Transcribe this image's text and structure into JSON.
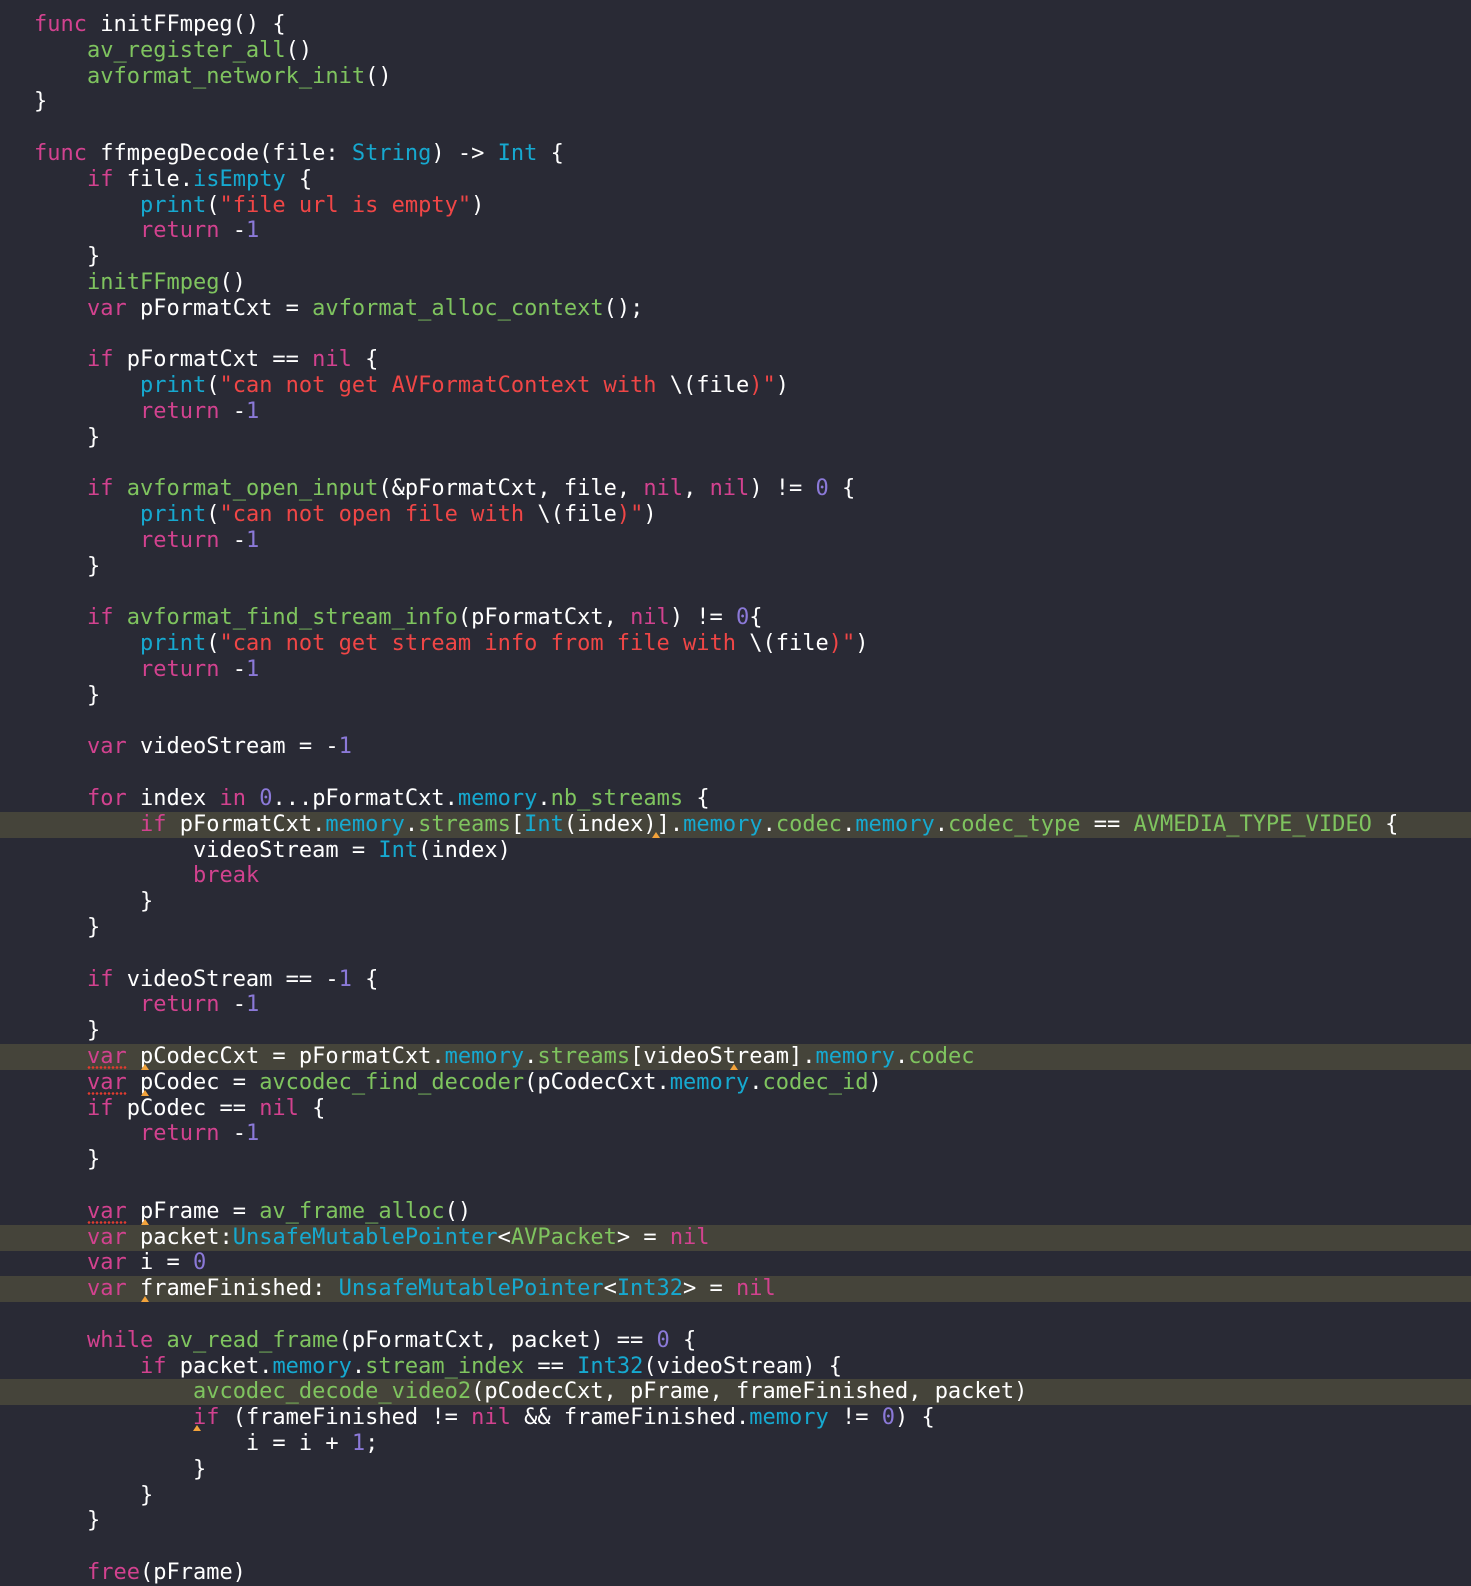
{
  "editor": {
    "language": "swift",
    "colors": {
      "background": "#292a35",
      "highlight_line": "#45443a",
      "keyword": "#d2428f",
      "function": "#7fc45f",
      "type": "#16a9d0",
      "string": "#f04646",
      "number": "#8b79d8",
      "plain": "#ffffff",
      "warning_underline": "#e23b2f",
      "warning_marker": "#f2a23a"
    },
    "lines": [
      {
        "tokens": [
          [
            "func",
            "kw"
          ],
          [
            " initFFmpeg() {",
            "plain"
          ]
        ]
      },
      {
        "tokens": [
          [
            "    ",
            "plain"
          ],
          [
            "av_register_all",
            "fn"
          ],
          [
            "()",
            "plain"
          ]
        ]
      },
      {
        "tokens": [
          [
            "    ",
            "plain"
          ],
          [
            "avformat_network_init",
            "fn"
          ],
          [
            "()",
            "plain"
          ]
        ]
      },
      {
        "tokens": [
          [
            "}",
            "plain"
          ]
        ]
      },
      {
        "tokens": []
      },
      {
        "tokens": [
          [
            "func",
            "kw"
          ],
          [
            " ffmpegDecode(file: ",
            "plain"
          ],
          [
            "String",
            "type"
          ],
          [
            ") -> ",
            "plain"
          ],
          [
            "Int",
            "type"
          ],
          [
            " {",
            "plain"
          ]
        ]
      },
      {
        "tokens": [
          [
            "    ",
            "plain"
          ],
          [
            "if",
            "kw"
          ],
          [
            " file.",
            "plain"
          ],
          [
            "isEmpty",
            "prop"
          ],
          [
            " {",
            "plain"
          ]
        ]
      },
      {
        "tokens": [
          [
            "        ",
            "plain"
          ],
          [
            "print",
            "type"
          ],
          [
            "(",
            "plain"
          ],
          [
            "\"file url is empty\"",
            "str"
          ],
          [
            ")",
            "plain"
          ]
        ]
      },
      {
        "tokens": [
          [
            "        ",
            "plain"
          ],
          [
            "return",
            "kw"
          ],
          [
            " -",
            "plain"
          ],
          [
            "1",
            "num"
          ]
        ]
      },
      {
        "tokens": [
          [
            "    }",
            "plain"
          ]
        ]
      },
      {
        "tokens": [
          [
            "    ",
            "plain"
          ],
          [
            "initFFmpeg",
            "fn"
          ],
          [
            "()",
            "plain"
          ]
        ]
      },
      {
        "tokens": [
          [
            "    ",
            "plain"
          ],
          [
            "var",
            "kw"
          ],
          [
            " pFormatCxt = ",
            "plain"
          ],
          [
            "avformat_alloc_context",
            "fn"
          ],
          [
            "();",
            "plain"
          ]
        ]
      },
      {
        "tokens": []
      },
      {
        "tokens": [
          [
            "    ",
            "plain"
          ],
          [
            "if",
            "kw"
          ],
          [
            " pFormatCxt == ",
            "plain"
          ],
          [
            "nil",
            "kw"
          ],
          [
            " {",
            "plain"
          ]
        ]
      },
      {
        "tokens": [
          [
            "        ",
            "plain"
          ],
          [
            "print",
            "type"
          ],
          [
            "(",
            "plain"
          ],
          [
            "\"can not get AVFormatContext with ",
            "str"
          ],
          [
            "\\(file",
            "plain"
          ],
          [
            ")\"",
            "str"
          ],
          [
            ")",
            "plain"
          ]
        ]
      },
      {
        "tokens": [
          [
            "        ",
            "plain"
          ],
          [
            "return",
            "kw"
          ],
          [
            " -",
            "plain"
          ],
          [
            "1",
            "num"
          ]
        ]
      },
      {
        "tokens": [
          [
            "    }",
            "plain"
          ]
        ]
      },
      {
        "tokens": []
      },
      {
        "tokens": [
          [
            "    ",
            "plain"
          ],
          [
            "if",
            "kw"
          ],
          [
            " ",
            "plain"
          ],
          [
            "avformat_open_input",
            "fn"
          ],
          [
            "(&pFormatCxt, file, ",
            "plain"
          ],
          [
            "nil",
            "kw"
          ],
          [
            ", ",
            "plain"
          ],
          [
            "nil",
            "kw"
          ],
          [
            ") != ",
            "plain"
          ],
          [
            "0",
            "num"
          ],
          [
            " {",
            "plain"
          ]
        ]
      },
      {
        "tokens": [
          [
            "        ",
            "plain"
          ],
          [
            "print",
            "type"
          ],
          [
            "(",
            "plain"
          ],
          [
            "\"can not open file with ",
            "str"
          ],
          [
            "\\(file",
            "plain"
          ],
          [
            ")\"",
            "str"
          ],
          [
            ")",
            "plain"
          ]
        ]
      },
      {
        "tokens": [
          [
            "        ",
            "plain"
          ],
          [
            "return",
            "kw"
          ],
          [
            " -",
            "plain"
          ],
          [
            "1",
            "num"
          ]
        ]
      },
      {
        "tokens": [
          [
            "    }",
            "plain"
          ]
        ]
      },
      {
        "tokens": []
      },
      {
        "tokens": [
          [
            "    ",
            "plain"
          ],
          [
            "if",
            "kw"
          ],
          [
            " ",
            "plain"
          ],
          [
            "avformat_find_stream_info",
            "fn"
          ],
          [
            "(pFormatCxt, ",
            "plain"
          ],
          [
            "nil",
            "kw"
          ],
          [
            ") != ",
            "plain"
          ],
          [
            "0",
            "num"
          ],
          [
            "{",
            "plain"
          ]
        ]
      },
      {
        "tokens": [
          [
            "        ",
            "plain"
          ],
          [
            "print",
            "type"
          ],
          [
            "(",
            "plain"
          ],
          [
            "\"can not get stream info from file with ",
            "str"
          ],
          [
            "\\(file",
            "plain"
          ],
          [
            ")\"",
            "str"
          ],
          [
            ")",
            "plain"
          ]
        ]
      },
      {
        "tokens": [
          [
            "        ",
            "plain"
          ],
          [
            "return",
            "kw"
          ],
          [
            " -",
            "plain"
          ],
          [
            "1",
            "num"
          ]
        ]
      },
      {
        "tokens": [
          [
            "    }",
            "plain"
          ]
        ]
      },
      {
        "tokens": []
      },
      {
        "tokens": [
          [
            "    ",
            "plain"
          ],
          [
            "var",
            "kw"
          ],
          [
            " videoStream = -",
            "plain"
          ],
          [
            "1",
            "num"
          ]
        ]
      },
      {
        "tokens": []
      },
      {
        "tokens": [
          [
            "    ",
            "plain"
          ],
          [
            "for",
            "kw"
          ],
          [
            " index ",
            "plain"
          ],
          [
            "in",
            "kw"
          ],
          [
            " ",
            "plain"
          ],
          [
            "0",
            "num"
          ],
          [
            "...pFormatCxt.",
            "plain"
          ],
          [
            "memory",
            "prop"
          ],
          [
            ".",
            "plain"
          ],
          [
            "nb_streams",
            "fn"
          ],
          [
            " {",
            "plain"
          ]
        ]
      },
      {
        "highlight": true,
        "marker_col": 47,
        "tokens": [
          [
            "        ",
            "plain"
          ],
          [
            "if",
            "kw"
          ],
          [
            " pFormatCxt.",
            "plain"
          ],
          [
            "memory",
            "prop"
          ],
          [
            ".",
            "plain"
          ],
          [
            "streams",
            "fn"
          ],
          [
            "[",
            "plain"
          ],
          [
            "Int",
            "type"
          ],
          [
            "(index)].",
            "plain"
          ],
          [
            "memory",
            "prop"
          ],
          [
            ".",
            "plain"
          ],
          [
            "codec",
            "fn"
          ],
          [
            ".",
            "plain"
          ],
          [
            "memory",
            "prop"
          ],
          [
            ".",
            "plain"
          ],
          [
            "codec_type",
            "fn"
          ],
          [
            " == ",
            "plain"
          ],
          [
            "AVMEDIA_TYPE_VIDEO",
            "fn"
          ],
          [
            " {",
            "plain"
          ]
        ]
      },
      {
        "tokens": [
          [
            "            videoStream = ",
            "plain"
          ],
          [
            "Int",
            "type"
          ],
          [
            "(index)",
            "plain"
          ]
        ]
      },
      {
        "tokens": [
          [
            "            ",
            "plain"
          ],
          [
            "break",
            "kw"
          ]
        ]
      },
      {
        "tokens": [
          [
            "        }",
            "plain"
          ]
        ]
      },
      {
        "tokens": [
          [
            "    }",
            "plain"
          ]
        ]
      },
      {
        "tokens": []
      },
      {
        "tokens": [
          [
            "    ",
            "plain"
          ],
          [
            "if",
            "kw"
          ],
          [
            " videoStream == -",
            "plain"
          ],
          [
            "1",
            "num"
          ],
          [
            " {",
            "plain"
          ]
        ]
      },
      {
        "tokens": [
          [
            "        ",
            "plain"
          ],
          [
            "return",
            "kw"
          ],
          [
            " -",
            "plain"
          ],
          [
            "1",
            "num"
          ]
        ]
      },
      {
        "tokens": [
          [
            "    }",
            "plain"
          ]
        ]
      },
      {
        "highlight": true,
        "marker_col": 8,
        "marker_col2": 53,
        "tokens": [
          [
            "    ",
            "plain"
          ],
          [
            "var",
            "kw warn"
          ],
          [
            " pCodecCxt = pFormatCxt.",
            "plain"
          ],
          [
            "memory",
            "prop"
          ],
          [
            ".",
            "plain"
          ],
          [
            "streams",
            "fn"
          ],
          [
            "[videoStream].",
            "plain"
          ],
          [
            "memory",
            "prop"
          ],
          [
            ".",
            "plain"
          ],
          [
            "codec",
            "fn"
          ]
        ]
      },
      {
        "marker_col": 8,
        "tokens": [
          [
            "    ",
            "plain"
          ],
          [
            "var",
            "kw warn"
          ],
          [
            " pCodec = ",
            "plain"
          ],
          [
            "avcodec_find_decoder",
            "fn"
          ],
          [
            "(pCodecCxt.",
            "plain"
          ],
          [
            "memory",
            "prop"
          ],
          [
            ".",
            "plain"
          ],
          [
            "codec_id",
            "fn"
          ],
          [
            ")",
            "plain"
          ]
        ]
      },
      {
        "tokens": [
          [
            "    ",
            "plain"
          ],
          [
            "if",
            "kw"
          ],
          [
            " pCodec == ",
            "plain"
          ],
          [
            "nil",
            "kw"
          ],
          [
            " {",
            "plain"
          ]
        ]
      },
      {
        "tokens": [
          [
            "        ",
            "plain"
          ],
          [
            "return",
            "kw"
          ],
          [
            " -",
            "plain"
          ],
          [
            "1",
            "num"
          ]
        ]
      },
      {
        "tokens": [
          [
            "    }",
            "plain"
          ]
        ]
      },
      {
        "tokens": []
      },
      {
        "marker_col": 8,
        "tokens": [
          [
            "    ",
            "plain"
          ],
          [
            "var",
            "kw warn"
          ],
          [
            " pFrame = ",
            "plain"
          ],
          [
            "av_frame_alloc",
            "fn"
          ],
          [
            "()",
            "plain"
          ]
        ]
      },
      {
        "highlight": true,
        "tokens": [
          [
            "    ",
            "plain"
          ],
          [
            "var",
            "kw"
          ],
          [
            " packet:",
            "plain"
          ],
          [
            "UnsafeMutablePointer",
            "type"
          ],
          [
            "<",
            "plain"
          ],
          [
            "AVPacket",
            "fn"
          ],
          [
            "> = ",
            "plain"
          ],
          [
            "nil",
            "kw"
          ]
        ]
      },
      {
        "tokens": [
          [
            "    ",
            "plain"
          ],
          [
            "var",
            "kw"
          ],
          [
            " i = ",
            "plain"
          ],
          [
            "0",
            "num"
          ]
        ]
      },
      {
        "highlight": true,
        "marker_col": 8,
        "tokens": [
          [
            "    ",
            "plain"
          ],
          [
            "var",
            "kw"
          ],
          [
            " frameFinished: ",
            "plain"
          ],
          [
            "UnsafeMutablePointer",
            "type"
          ],
          [
            "<",
            "plain"
          ],
          [
            "Int32",
            "type"
          ],
          [
            "> = ",
            "plain"
          ],
          [
            "nil",
            "kw"
          ]
        ]
      },
      {
        "tokens": []
      },
      {
        "tokens": [
          [
            "    ",
            "plain"
          ],
          [
            "while",
            "kw"
          ],
          [
            " ",
            "plain"
          ],
          [
            "av_read_frame",
            "fn"
          ],
          [
            "(pFormatCxt, packet) == ",
            "plain"
          ],
          [
            "0",
            "num"
          ],
          [
            " {",
            "plain"
          ]
        ]
      },
      {
        "tokens": [
          [
            "        ",
            "plain"
          ],
          [
            "if",
            "kw"
          ],
          [
            " packet.",
            "plain"
          ],
          [
            "memory",
            "prop"
          ],
          [
            ".",
            "plain"
          ],
          [
            "stream_index",
            "fn"
          ],
          [
            " == ",
            "plain"
          ],
          [
            "Int32",
            "type"
          ],
          [
            "(videoStream) {",
            "plain"
          ]
        ]
      },
      {
        "highlight": true,
        "tokens": [
          [
            "            ",
            "plain"
          ],
          [
            "avcodec_decode_video2",
            "fn"
          ],
          [
            "(pCodecCxt, pFrame, frameFinished, packet)",
            "plain"
          ]
        ]
      },
      {
        "marker_col": 12,
        "tokens": [
          [
            "            ",
            "plain"
          ],
          [
            "if",
            "kw"
          ],
          [
            " (frameFinished != ",
            "plain"
          ],
          [
            "nil",
            "kw"
          ],
          [
            " && frameFinished.",
            "plain"
          ],
          [
            "memory",
            "prop"
          ],
          [
            " != ",
            "plain"
          ],
          [
            "0",
            "num"
          ],
          [
            ") {",
            "plain"
          ]
        ]
      },
      {
        "tokens": [
          [
            "                i = i + ",
            "plain"
          ],
          [
            "1",
            "num"
          ],
          [
            ";",
            "plain"
          ]
        ]
      },
      {
        "tokens": [
          [
            "            }",
            "plain"
          ]
        ]
      },
      {
        "tokens": [
          [
            "        }",
            "plain"
          ]
        ]
      },
      {
        "tokens": [
          [
            "    }",
            "plain"
          ]
        ]
      },
      {
        "tokens": []
      },
      {
        "tokens": [
          [
            "    ",
            "plain"
          ],
          [
            "free",
            "kw"
          ],
          [
            "(pFrame)",
            "plain"
          ]
        ]
      }
    ]
  }
}
